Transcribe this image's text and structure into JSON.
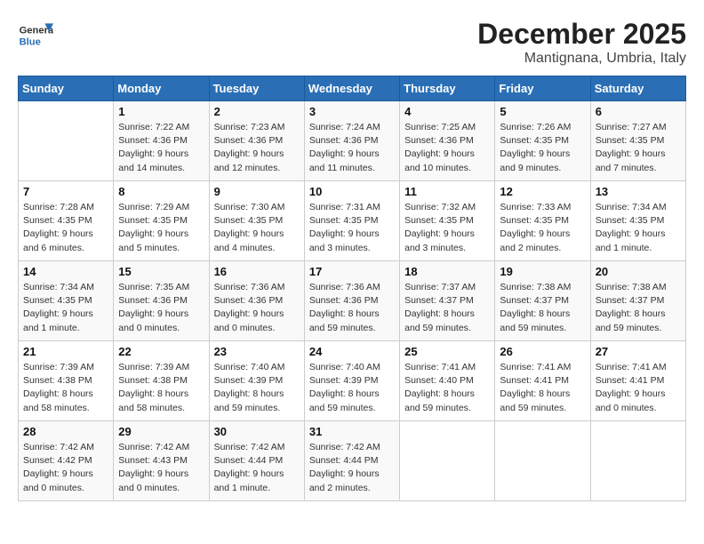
{
  "logo": {
    "general": "General",
    "blue": "Blue"
  },
  "title": {
    "month_year": "December 2025",
    "location": "Mantignana, Umbria, Italy"
  },
  "weekdays": [
    "Sunday",
    "Monday",
    "Tuesday",
    "Wednesday",
    "Thursday",
    "Friday",
    "Saturday"
  ],
  "weeks": [
    [
      {
        "day": "",
        "info": ""
      },
      {
        "day": "1",
        "info": "Sunrise: 7:22 AM\nSunset: 4:36 PM\nDaylight: 9 hours\nand 14 minutes."
      },
      {
        "day": "2",
        "info": "Sunrise: 7:23 AM\nSunset: 4:36 PM\nDaylight: 9 hours\nand 12 minutes."
      },
      {
        "day": "3",
        "info": "Sunrise: 7:24 AM\nSunset: 4:36 PM\nDaylight: 9 hours\nand 11 minutes."
      },
      {
        "day": "4",
        "info": "Sunrise: 7:25 AM\nSunset: 4:36 PM\nDaylight: 9 hours\nand 10 minutes."
      },
      {
        "day": "5",
        "info": "Sunrise: 7:26 AM\nSunset: 4:35 PM\nDaylight: 9 hours\nand 9 minutes."
      },
      {
        "day": "6",
        "info": "Sunrise: 7:27 AM\nSunset: 4:35 PM\nDaylight: 9 hours\nand 7 minutes."
      }
    ],
    [
      {
        "day": "7",
        "info": "Sunrise: 7:28 AM\nSunset: 4:35 PM\nDaylight: 9 hours\nand 6 minutes."
      },
      {
        "day": "8",
        "info": "Sunrise: 7:29 AM\nSunset: 4:35 PM\nDaylight: 9 hours\nand 5 minutes."
      },
      {
        "day": "9",
        "info": "Sunrise: 7:30 AM\nSunset: 4:35 PM\nDaylight: 9 hours\nand 4 minutes."
      },
      {
        "day": "10",
        "info": "Sunrise: 7:31 AM\nSunset: 4:35 PM\nDaylight: 9 hours\nand 3 minutes."
      },
      {
        "day": "11",
        "info": "Sunrise: 7:32 AM\nSunset: 4:35 PM\nDaylight: 9 hours\nand 3 minutes."
      },
      {
        "day": "12",
        "info": "Sunrise: 7:33 AM\nSunset: 4:35 PM\nDaylight: 9 hours\nand 2 minutes."
      },
      {
        "day": "13",
        "info": "Sunrise: 7:34 AM\nSunset: 4:35 PM\nDaylight: 9 hours\nand 1 minute."
      }
    ],
    [
      {
        "day": "14",
        "info": "Sunrise: 7:34 AM\nSunset: 4:35 PM\nDaylight: 9 hours\nand 1 minute."
      },
      {
        "day": "15",
        "info": "Sunrise: 7:35 AM\nSunset: 4:36 PM\nDaylight: 9 hours\nand 0 minutes."
      },
      {
        "day": "16",
        "info": "Sunrise: 7:36 AM\nSunset: 4:36 PM\nDaylight: 9 hours\nand 0 minutes."
      },
      {
        "day": "17",
        "info": "Sunrise: 7:36 AM\nSunset: 4:36 PM\nDaylight: 8 hours\nand 59 minutes."
      },
      {
        "day": "18",
        "info": "Sunrise: 7:37 AM\nSunset: 4:37 PM\nDaylight: 8 hours\nand 59 minutes."
      },
      {
        "day": "19",
        "info": "Sunrise: 7:38 AM\nSunset: 4:37 PM\nDaylight: 8 hours\nand 59 minutes."
      },
      {
        "day": "20",
        "info": "Sunrise: 7:38 AM\nSunset: 4:37 PM\nDaylight: 8 hours\nand 59 minutes."
      }
    ],
    [
      {
        "day": "21",
        "info": "Sunrise: 7:39 AM\nSunset: 4:38 PM\nDaylight: 8 hours\nand 58 minutes."
      },
      {
        "day": "22",
        "info": "Sunrise: 7:39 AM\nSunset: 4:38 PM\nDaylight: 8 hours\nand 58 minutes."
      },
      {
        "day": "23",
        "info": "Sunrise: 7:40 AM\nSunset: 4:39 PM\nDaylight: 8 hours\nand 59 minutes."
      },
      {
        "day": "24",
        "info": "Sunrise: 7:40 AM\nSunset: 4:39 PM\nDaylight: 8 hours\nand 59 minutes."
      },
      {
        "day": "25",
        "info": "Sunrise: 7:41 AM\nSunset: 4:40 PM\nDaylight: 8 hours\nand 59 minutes."
      },
      {
        "day": "26",
        "info": "Sunrise: 7:41 AM\nSunset: 4:41 PM\nDaylight: 8 hours\nand 59 minutes."
      },
      {
        "day": "27",
        "info": "Sunrise: 7:41 AM\nSunset: 4:41 PM\nDaylight: 9 hours\nand 0 minutes."
      }
    ],
    [
      {
        "day": "28",
        "info": "Sunrise: 7:42 AM\nSunset: 4:42 PM\nDaylight: 9 hours\nand 0 minutes."
      },
      {
        "day": "29",
        "info": "Sunrise: 7:42 AM\nSunset: 4:43 PM\nDaylight: 9 hours\nand 0 minutes."
      },
      {
        "day": "30",
        "info": "Sunrise: 7:42 AM\nSunset: 4:44 PM\nDaylight: 9 hours\nand 1 minute."
      },
      {
        "day": "31",
        "info": "Sunrise: 7:42 AM\nSunset: 4:44 PM\nDaylight: 9 hours\nand 2 minutes."
      },
      {
        "day": "",
        "info": ""
      },
      {
        "day": "",
        "info": ""
      },
      {
        "day": "",
        "info": ""
      }
    ]
  ]
}
